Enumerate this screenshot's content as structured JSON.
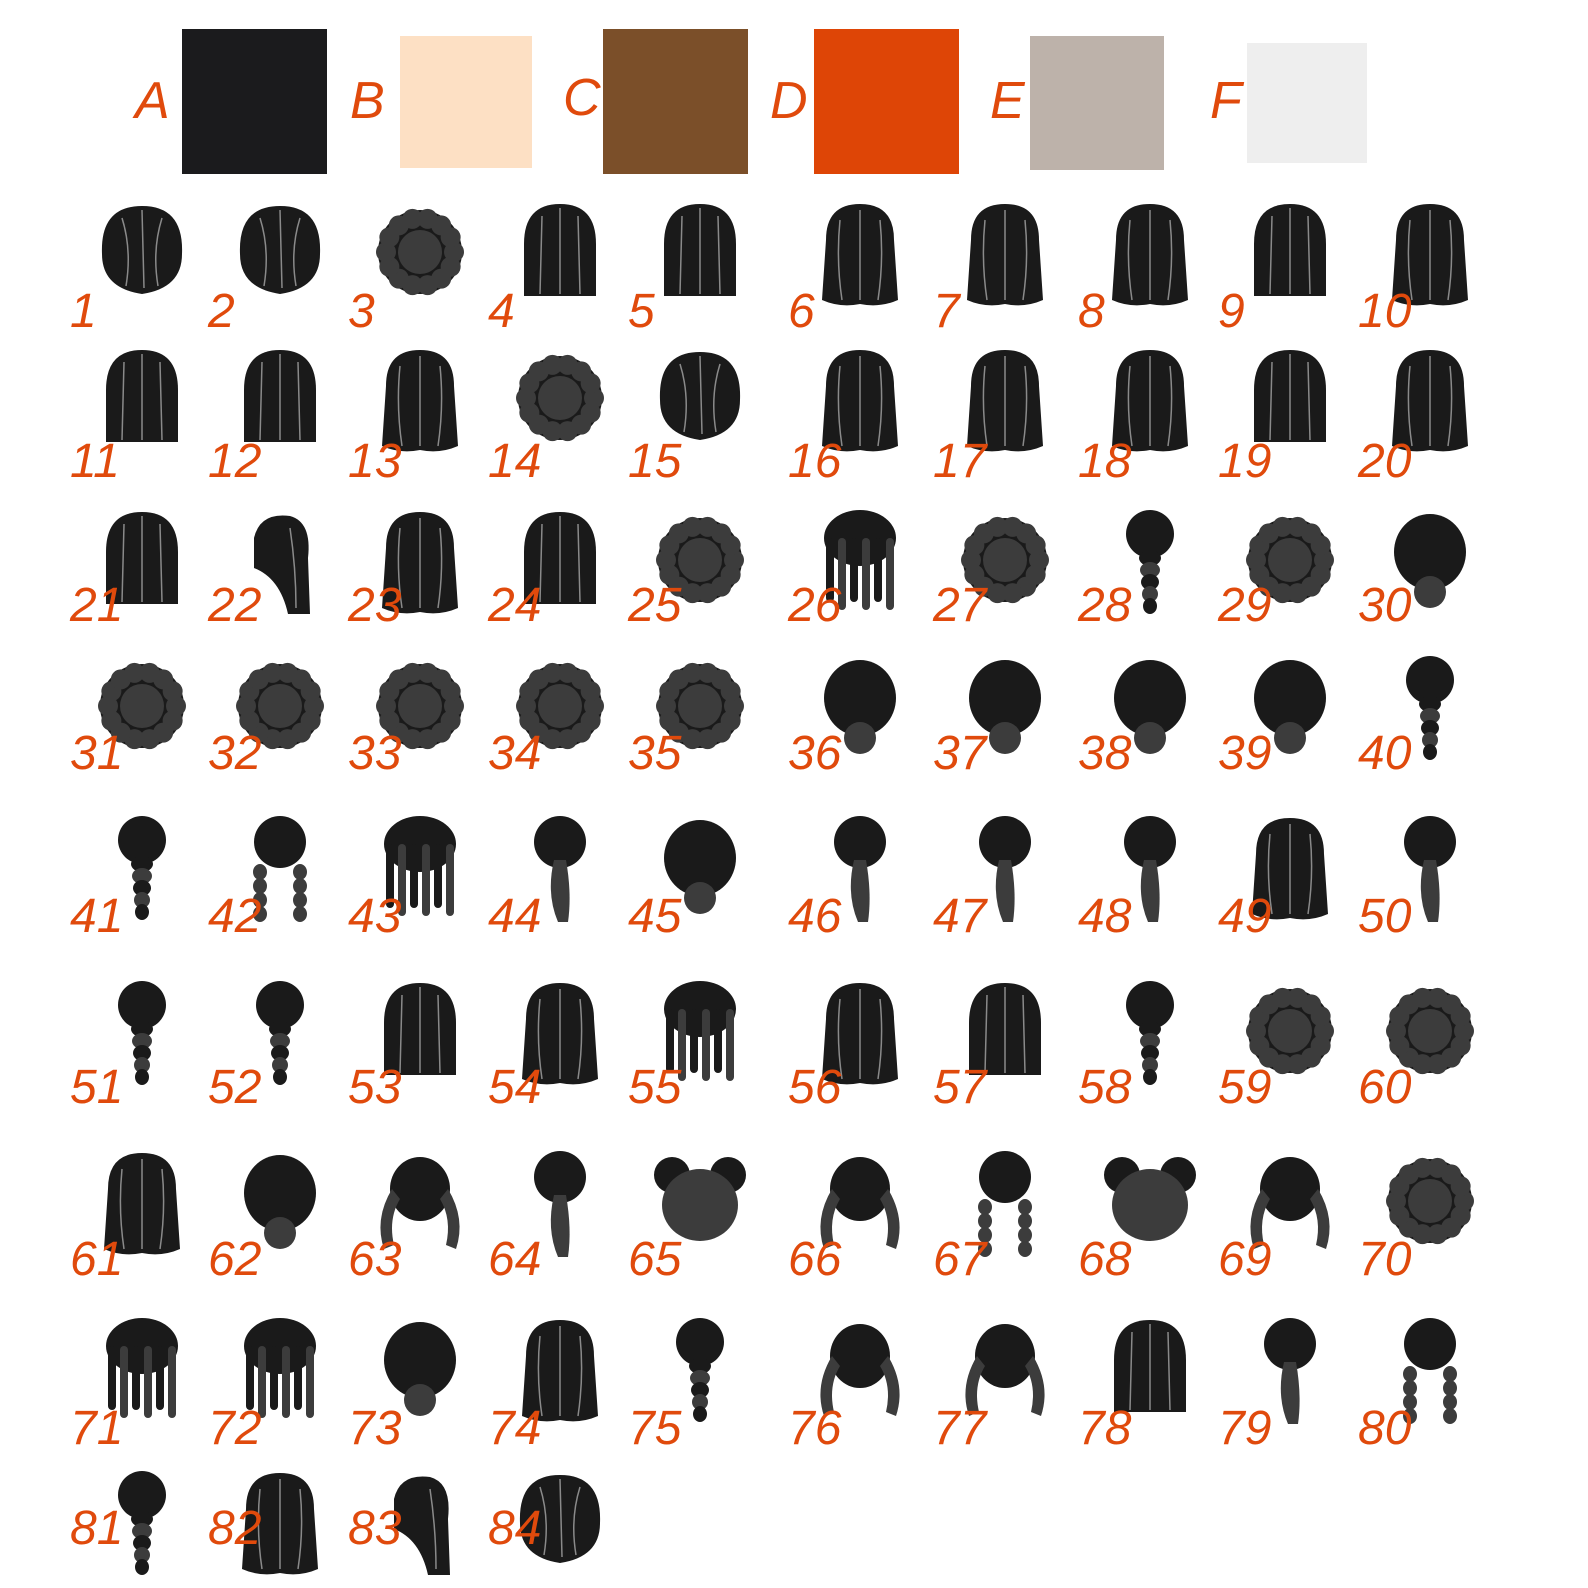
{
  "swatches": [
    {
      "label": "A",
      "color": "#1b1b1d"
    },
    {
      "label": "B",
      "color": "#fde0c4"
    },
    {
      "label": "C",
      "color": "#7b4f29"
    },
    {
      "label": "D",
      "color": "#de4506"
    },
    {
      "label": "E",
      "color": "#bdb2aa"
    },
    {
      "label": "F",
      "color": "#eeeeee"
    }
  ],
  "label_color": "#e04a0c",
  "hairstyles": [
    {
      "number": "1",
      "icon": "short-hair-icon"
    },
    {
      "number": "2",
      "icon": "short-hair-icon"
    },
    {
      "number": "3",
      "icon": "curly-hair-icon"
    },
    {
      "number": "4",
      "icon": "bob-hair-icon"
    },
    {
      "number": "5",
      "icon": "bob-hair-icon"
    },
    {
      "number": "6",
      "icon": "wavy-hair-icon"
    },
    {
      "number": "7",
      "icon": "wavy-hair-icon"
    },
    {
      "number": "8",
      "icon": "half-up-hair-icon"
    },
    {
      "number": "9",
      "icon": "straight-hair-icon"
    },
    {
      "number": "10",
      "icon": "layered-hair-icon"
    },
    {
      "number": "11",
      "icon": "straight-hair-icon"
    },
    {
      "number": "12",
      "icon": "straight-hair-icon"
    },
    {
      "number": "13",
      "icon": "wavy-hair-icon"
    },
    {
      "number": "14",
      "icon": "curly-hair-icon"
    },
    {
      "number": "15",
      "icon": "short-hair-icon"
    },
    {
      "number": "16",
      "icon": "wavy-hair-icon"
    },
    {
      "number": "17",
      "icon": "wavy-hair-icon"
    },
    {
      "number": "18",
      "icon": "long-hair-icon"
    },
    {
      "number": "19",
      "icon": "straight-hair-icon"
    },
    {
      "number": "20",
      "icon": "layered-hair-icon"
    },
    {
      "number": "21",
      "icon": "straight-hair-icon"
    },
    {
      "number": "22",
      "icon": "side-hair-icon"
    },
    {
      "number": "23",
      "icon": "wavy-hair-icon"
    },
    {
      "number": "24",
      "icon": "straight-hair-icon"
    },
    {
      "number": "25",
      "icon": "curly-hair-icon"
    },
    {
      "number": "26",
      "icon": "braided-hair-icon"
    },
    {
      "number": "27",
      "icon": "curly-hair-icon"
    },
    {
      "number": "28",
      "icon": "braid-hair-icon"
    },
    {
      "number": "29",
      "icon": "afro-hair-icon"
    },
    {
      "number": "30",
      "icon": "bun-hair-icon"
    },
    {
      "number": "31",
      "icon": "afro-hair-icon"
    },
    {
      "number": "32",
      "icon": "afro-hair-icon"
    },
    {
      "number": "33",
      "icon": "afro-hair-icon"
    },
    {
      "number": "34",
      "icon": "curly-hair-icon"
    },
    {
      "number": "35",
      "icon": "curly-hair-icon"
    },
    {
      "number": "36",
      "icon": "bun-hair-icon"
    },
    {
      "number": "37",
      "icon": "bun-hair-icon"
    },
    {
      "number": "38",
      "icon": "updo-hair-icon"
    },
    {
      "number": "39",
      "icon": "updo-hair-icon"
    },
    {
      "number": "40",
      "icon": "braid-hair-icon"
    },
    {
      "number": "41",
      "icon": "braid-hair-icon"
    },
    {
      "number": "42",
      "icon": "pigtail-braids-hair-icon"
    },
    {
      "number": "43",
      "icon": "braided-hair-icon"
    },
    {
      "number": "44",
      "icon": "ponytail-hair-icon"
    },
    {
      "number": "45",
      "icon": "bun-hair-icon"
    },
    {
      "number": "46",
      "icon": "ponytail-hair-icon"
    },
    {
      "number": "47",
      "icon": "ponytail-hair-icon"
    },
    {
      "number": "48",
      "icon": "ponytail-hair-icon"
    },
    {
      "number": "49",
      "icon": "half-up-hair-icon"
    },
    {
      "number": "50",
      "icon": "ponytail-hair-icon"
    },
    {
      "number": "51",
      "icon": "braid-hair-icon"
    },
    {
      "number": "52",
      "icon": "braid-hair-icon"
    },
    {
      "number": "53",
      "icon": "straight-hair-icon"
    },
    {
      "number": "54",
      "icon": "wavy-hair-icon"
    },
    {
      "number": "55",
      "icon": "locs-hair-icon"
    },
    {
      "number": "56",
      "icon": "wavy-hair-icon"
    },
    {
      "number": "57",
      "icon": "straight-hair-icon"
    },
    {
      "number": "58",
      "icon": "braid-hair-icon"
    },
    {
      "number": "59",
      "icon": "afro-hair-icon"
    },
    {
      "number": "60",
      "icon": "curly-hair-icon"
    },
    {
      "number": "61",
      "icon": "wavy-hair-icon"
    },
    {
      "number": "62",
      "icon": "bun-hair-icon"
    },
    {
      "number": "63",
      "icon": "pigtail-hair-icon"
    },
    {
      "number": "64",
      "icon": "ponytail-hair-icon"
    },
    {
      "number": "65",
      "icon": "space-buns-hair-icon"
    },
    {
      "number": "66",
      "icon": "pigtail-hair-icon"
    },
    {
      "number": "67",
      "icon": "pigtail-braids-hair-icon"
    },
    {
      "number": "68",
      "icon": "space-buns-hair-icon"
    },
    {
      "number": "69",
      "icon": "pigtail-hair-icon"
    },
    {
      "number": "70",
      "icon": "afro-hair-icon"
    },
    {
      "number": "71",
      "icon": "braided-hair-icon"
    },
    {
      "number": "72",
      "icon": "braided-hair-icon"
    },
    {
      "number": "73",
      "icon": "bun-hair-icon"
    },
    {
      "number": "74",
      "icon": "wavy-hair-icon"
    },
    {
      "number": "75",
      "icon": "braid-hair-icon"
    },
    {
      "number": "76",
      "icon": "pigtail-hair-icon"
    },
    {
      "number": "77",
      "icon": "pigtail-hair-icon"
    },
    {
      "number": "78",
      "icon": "straight-hair-icon"
    },
    {
      "number": "79",
      "icon": "ponytail-hair-icon"
    },
    {
      "number": "80",
      "icon": "pigtail-braids-hair-icon"
    },
    {
      "number": "81",
      "icon": "braid-hair-icon"
    },
    {
      "number": "82",
      "icon": "wavy-hair-icon"
    },
    {
      "number": "83",
      "icon": "side-hair-icon"
    },
    {
      "number": "84",
      "icon": "short-hair-icon"
    }
  ]
}
